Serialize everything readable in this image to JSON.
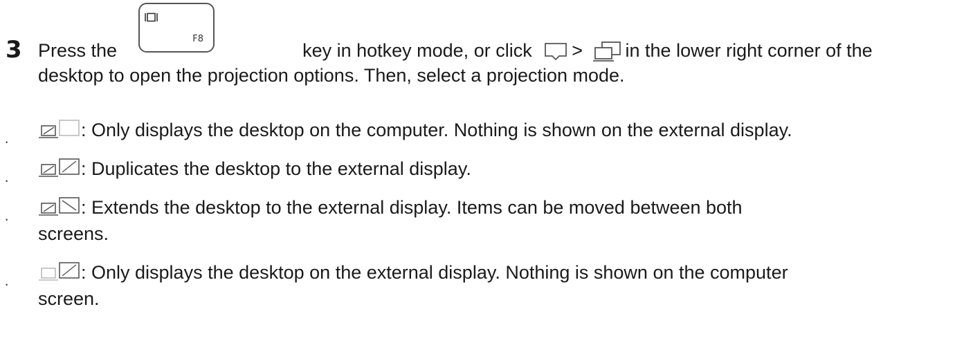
{
  "step": {
    "number": "3",
    "line1_part1": "Press the",
    "line1_part2": "key in hotkey mode, or click",
    "line1_sep": ">",
    "line1_part3": "in the lower right corner of the",
    "line2": "desktop to open the projection options. Then, select a projection mode.",
    "key_label": "F8"
  },
  "options": [
    {
      "text": ": Only displays the desktop on the computer. Nothing is shown on the external display.",
      "continuation": ""
    },
    {
      "text": ": Duplicates the desktop to the external display.",
      "continuation": ""
    },
    {
      "text": ": Extends the desktop to the external display. Items can be moved between both",
      "continuation": "screens."
    },
    {
      "text": ": Only displays the desktop on the external display. Nothing is shown on the computer",
      "continuation": "screen."
    }
  ],
  "bullet_char": "·",
  "icons": {
    "key_icon": "display-toggle-icon",
    "action_center": "action-center-icon",
    "project": "project-icon",
    "pc_only": "pc-screen-only-icon",
    "duplicate": "duplicate-icon",
    "extend": "extend-icon",
    "second_only": "second-screen-only-icon"
  },
  "colors": {
    "text": "#1a1a1a",
    "icon_stroke": "#555555",
    "icon_light": "#bbbbbb"
  }
}
